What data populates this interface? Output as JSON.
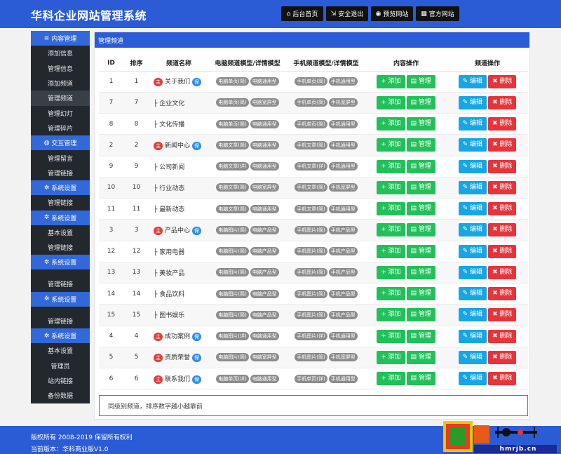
{
  "header": {
    "title": "华科企业网站管理系统",
    "nav": [
      {
        "label": "后台首页",
        "icon": "home-icon",
        "glyph": "⌂",
        "w": 60
      },
      {
        "label": "安全退出",
        "icon": "logout-icon",
        "glyph": "⇲",
        "w": 60
      },
      {
        "label": "预览网站",
        "icon": "eye-icon",
        "glyph": "◉",
        "w": 60
      },
      {
        "label": "官方网站",
        "icon": "grid-icon",
        "glyph": "▦",
        "w": 62
      }
    ]
  },
  "sidebar": {
    "items": [
      {
        "type": "head",
        "label": "内容管理",
        "icon": "list-icon",
        "glyph": "≡"
      },
      {
        "type": "item",
        "label": "添加信息"
      },
      {
        "type": "item",
        "label": "管理信息"
      },
      {
        "type": "item",
        "label": "添加频道"
      },
      {
        "type": "item",
        "label": "管理频道",
        "active": true
      },
      {
        "type": "item",
        "label": "管理幻灯"
      },
      {
        "type": "item",
        "label": "管理碎片"
      },
      {
        "type": "head",
        "label": "交互管理",
        "icon": "globe-icon",
        "glyph": "◍"
      },
      {
        "type": "item",
        "label": "管理留言"
      },
      {
        "type": "item",
        "label": "管理链接"
      },
      {
        "type": "head",
        "label": "系统设置",
        "icon": "gear-icon",
        "glyph": "✲"
      },
      {
        "type": "item",
        "label": "管理链接"
      },
      {
        "type": "head",
        "label": "系统设置",
        "icon": "gear-icon",
        "glyph": "✲"
      },
      {
        "type": "item",
        "label": "基本设置"
      },
      {
        "type": "item",
        "label": "管理链接"
      },
      {
        "type": "head",
        "label": "系统设置",
        "icon": "gear-icon",
        "glyph": "✲"
      },
      {
        "type": "gap",
        "label": ""
      },
      {
        "type": "item",
        "label": "管理链接"
      },
      {
        "type": "head",
        "label": "系统设置",
        "icon": "gear-icon",
        "glyph": "✲"
      },
      {
        "type": "gap",
        "label": ""
      },
      {
        "type": "item",
        "label": "管理链接"
      },
      {
        "type": "head",
        "label": "系统设置",
        "icon": "gear-icon",
        "glyph": "✲"
      },
      {
        "type": "item",
        "label": "基本设置"
      },
      {
        "type": "item",
        "label": "管理员"
      },
      {
        "type": "item",
        "label": "站内链接"
      },
      {
        "type": "item",
        "label": "备份数据"
      }
    ]
  },
  "panel": {
    "breadcrumb": "管理频道",
    "columns": [
      "ID",
      "排序",
      "频道名称",
      "电脑频道模型/详情模型",
      "手机频道模型/详情模型",
      "内容操作",
      "频道操作"
    ],
    "rows": [
      {
        "id": "1",
        "sort": "1",
        "name": "关于我们",
        "top": true,
        "pc": [
          "电脑单页(简)",
          "电脑通用型"
        ],
        "mobile": [
          "手机单页(简)",
          "手机通用型"
        ]
      },
      {
        "id": "7",
        "sort": "7",
        "name": "├ 企业文化",
        "top": false,
        "pc": [
          "电脑单页(简)",
          "电脑宽屏型"
        ],
        "mobile": [
          "手机单页(简)",
          "手机宽屏型"
        ]
      },
      {
        "id": "8",
        "sort": "8",
        "name": "├ 文化传播",
        "top": false,
        "pc": [
          "电脑单页(简)",
          "电脑通用型"
        ],
        "mobile": [
          "手机单页(简)",
          "手机通用型"
        ]
      },
      {
        "id": "2",
        "sort": "2",
        "name": "新闻中心",
        "top": true,
        "pc": [
          "电脑文章(简)",
          "电脑通用型"
        ],
        "mobile": [
          "手机文章(简)",
          "手机通用型"
        ]
      },
      {
        "id": "9",
        "sort": "9",
        "name": "├ 公司新闻",
        "top": false,
        "pc": [
          "电脑文章(详)",
          "电脑通用型"
        ],
        "mobile": [
          "手机文章(详)",
          "手机通用型"
        ]
      },
      {
        "id": "10",
        "sort": "10",
        "name": "├ 行业动态",
        "top": false,
        "pc": [
          "电脑文章(简)",
          "电脑宽屏型"
        ],
        "mobile": [
          "手机文章(简)",
          "手机宽屏型"
        ]
      },
      {
        "id": "11",
        "sort": "11",
        "name": "├ 最新动态",
        "top": false,
        "pc": [
          "电脑文章(简)",
          "电脑通用型"
        ],
        "mobile": [
          "手机文章(简)",
          "手机通用型"
        ]
      },
      {
        "id": "3",
        "sort": "3",
        "name": "产品中心",
        "top": true,
        "pc": [
          "电脑图片(简)",
          "电脑产品型"
        ],
        "mobile": [
          "手机图片(简)",
          "手机产品型"
        ]
      },
      {
        "id": "12",
        "sort": "12",
        "name": "├ 家用电器",
        "top": false,
        "pc": [
          "电脑图片(简)",
          "电脑产品型"
        ],
        "mobile": [
          "手机图片(简)",
          "手机产品型"
        ]
      },
      {
        "id": "13",
        "sort": "13",
        "name": "├ 美妆产品",
        "top": false,
        "pc": [
          "电脑图片(简)",
          "电脑产品型"
        ],
        "mobile": [
          "手机图片(简)",
          "手机产品型"
        ]
      },
      {
        "id": "14",
        "sort": "14",
        "name": "├ 食品饮料",
        "top": false,
        "pc": [
          "电脑图片(简)",
          "电脑产品型"
        ],
        "mobile": [
          "手机图片(简)",
          "手机产品型"
        ]
      },
      {
        "id": "15",
        "sort": "15",
        "name": "├ 图书娱乐",
        "top": false,
        "pc": [
          "电脑图片(简)",
          "电脑产品型"
        ],
        "mobile": [
          "手机图片(简)",
          "手机产品型"
        ]
      },
      {
        "id": "4",
        "sort": "4",
        "name": "成功案例",
        "top": true,
        "pc": [
          "电脑图片(详)",
          "电脑通用型"
        ],
        "mobile": [
          "手机图片(详)",
          "手机通用型"
        ]
      },
      {
        "id": "5",
        "sort": "5",
        "name": "资质荣誉",
        "top": true,
        "pc": [
          "电脑图片(简)",
          "电脑宽屏型"
        ],
        "mobile": [
          "手机图片(简)",
          "手机宽屏型"
        ]
      },
      {
        "id": "6",
        "sort": "6",
        "name": "联系我们",
        "top": true,
        "pc": [
          "电脑单页(详)",
          "电脑通用型"
        ],
        "mobile": [
          "手机单页(详)",
          "手机通用型"
        ]
      }
    ],
    "badge_main": "主",
    "badge_cover": "保",
    "btn_add": "+ 添加",
    "btn_manage": "管理",
    "btn_edit": "编辑",
    "btn_delete": "删除",
    "note": "同级别频道，排序数字越小越靠前"
  },
  "footer": {
    "copyright": "版权所有 2008-2019 保留所有权利",
    "version": "当前版本：华科商业版V1.0"
  },
  "watermark": {
    "text": "hmrjb.cn"
  },
  "colors": {
    "primary": "#2b5cd6",
    "green": "#22c05a",
    "cyan": "#17a6e5",
    "red": "#e8333a",
    "sidebar": "#23282e"
  }
}
